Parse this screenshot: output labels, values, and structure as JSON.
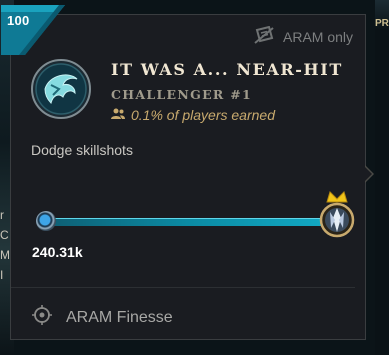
{
  "background": {
    "left_letters": [
      "r",
      "C",
      "M",
      "I"
    ],
    "right_label": "PRO"
  },
  "tooltip": {
    "level_badge": "100",
    "restriction_label": "ARAM only",
    "restriction_icon": "ticket-slash-icon",
    "emblem_icon": "dodge-emblem-icon",
    "title": "IT WAS A... NEAR-HIT",
    "rank": "CHALLENGER #1",
    "players_earned": "0.1% of players earned",
    "players_icon": "players-icon",
    "description": "Dodge skillshots",
    "progress": {
      "value_label": "240.31k",
      "fill_fraction": 1.0,
      "tier_icon": "challenger-crown-icon"
    },
    "category_label": "ARAM Finesse",
    "category_icon": "target-icon"
  },
  "colors": {
    "card_bg": "#1a1c21",
    "gold": "#c8aa6e",
    "title": "#f0e6d2",
    "progress": "#0b8aa3",
    "badge": "#0f7a95"
  }
}
